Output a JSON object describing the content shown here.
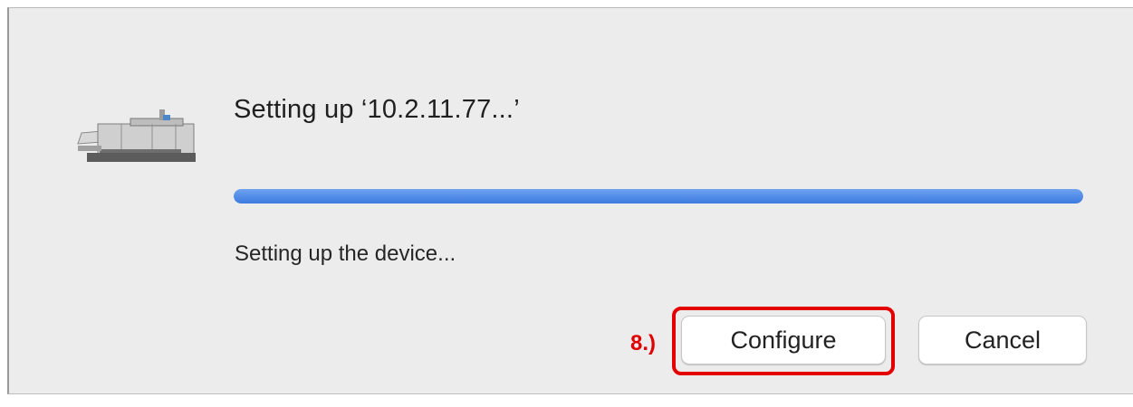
{
  "dialog": {
    "title": "Setting up ‘10.2.11.77...’",
    "progress": {
      "fraction": 1.0,
      "color": "#3b7ae0"
    },
    "status_text": "Setting up the device...",
    "icon": "printer-icon"
  },
  "annotation": {
    "step_label": "8.)",
    "color": "#e00000"
  },
  "buttons": {
    "configure_label": "Configure",
    "cancel_label": "Cancel"
  }
}
